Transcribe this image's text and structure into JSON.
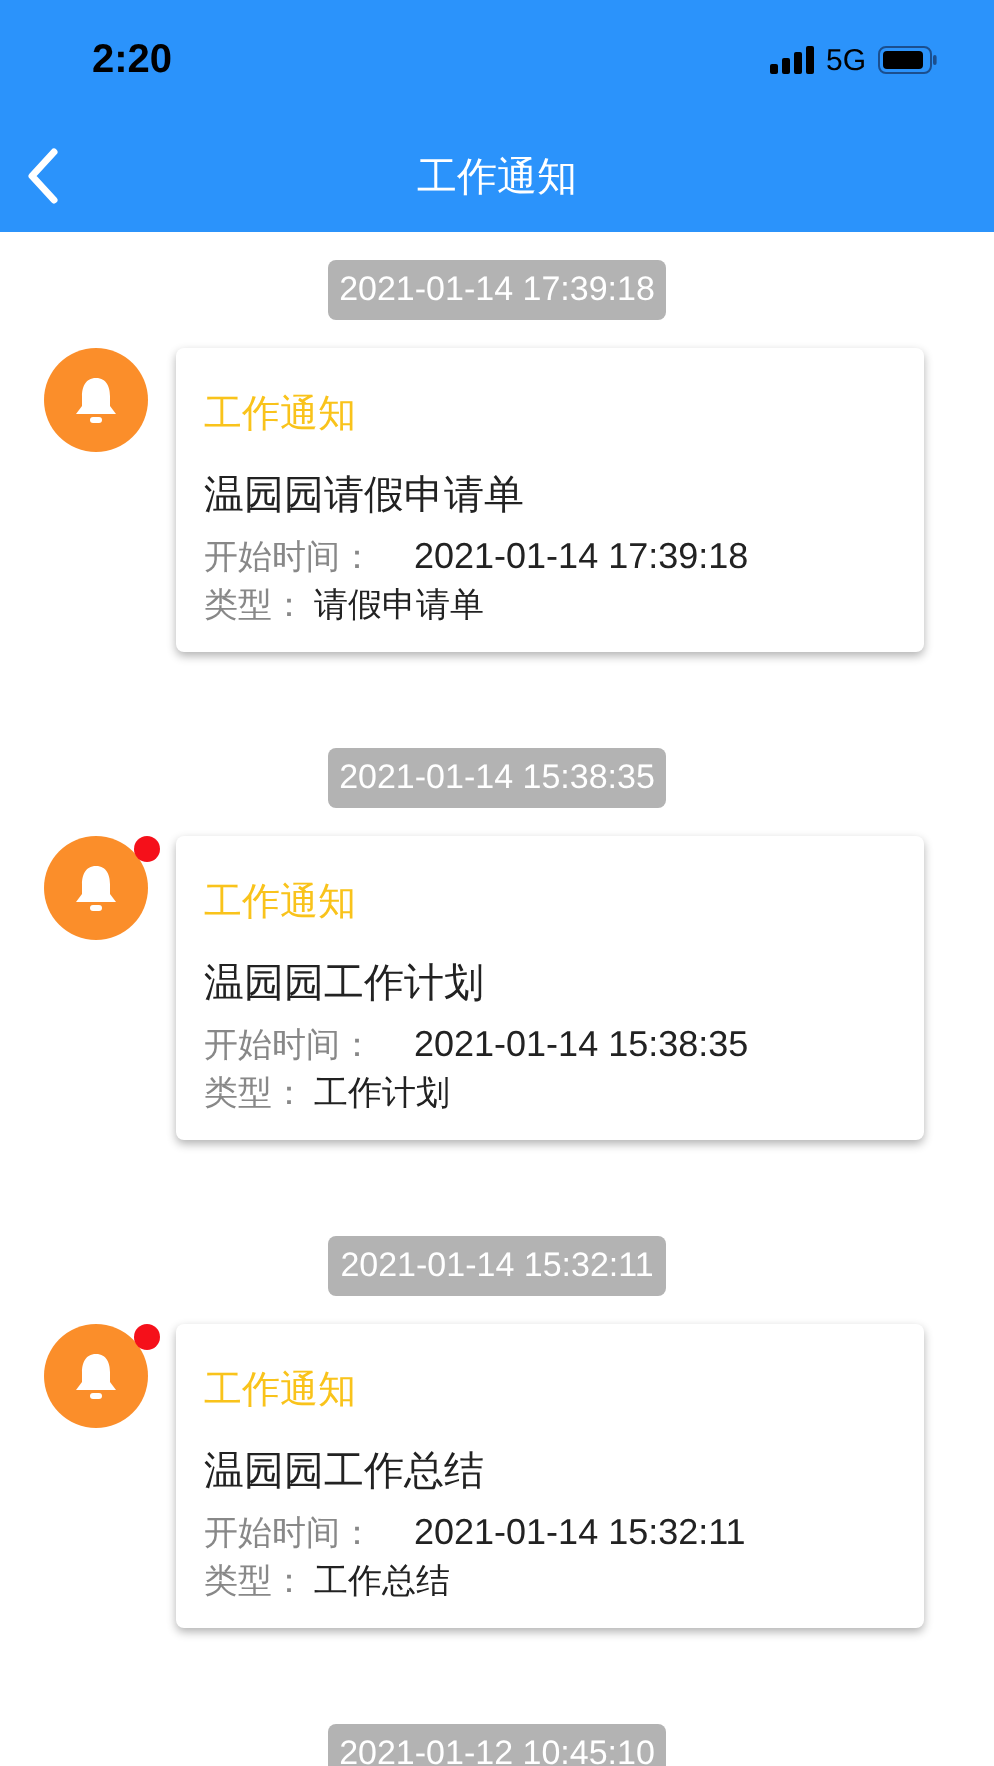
{
  "status_bar": {
    "time": "2:20",
    "network": "5G"
  },
  "header": {
    "title": "工作通知"
  },
  "notices": [
    {
      "timestamp": "2021-01-14 17:39:18",
      "category": "工作通知",
      "title": "温园园请假申请单",
      "start_label": "开始时间：",
      "start_time": "2021-01-14 17:39:18",
      "type_label": "类型：",
      "type": "请假申请单",
      "unread": false
    },
    {
      "timestamp": "2021-01-14 15:38:35",
      "category": "工作通知",
      "title": "温园园工作计划",
      "start_label": "开始时间：",
      "start_time": "2021-01-14 15:38:35",
      "type_label": "类型：",
      "type": "工作计划",
      "unread": true
    },
    {
      "timestamp": "2021-01-14 15:32:11",
      "category": "工作通知",
      "title": "温园园工作总结",
      "start_label": "开始时间：",
      "start_time": "2021-01-14 15:32:11",
      "type_label": "类型：",
      "type": "工作总结",
      "unread": true
    }
  ],
  "next_timestamp": "2021-01-12 10:45:10"
}
